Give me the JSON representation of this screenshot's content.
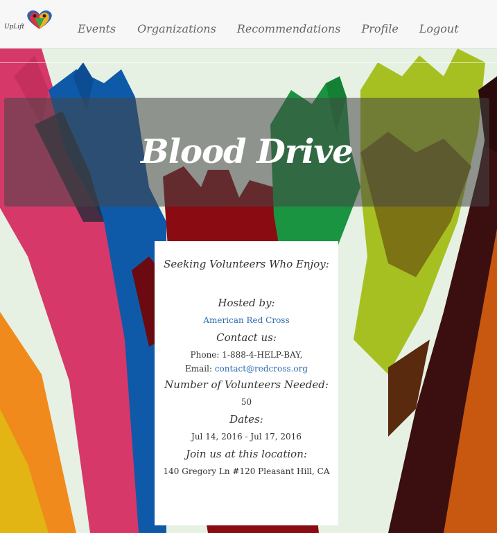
{
  "brand": {
    "text": "UpLift"
  },
  "nav": {
    "events": "Events",
    "organizations": "Organizations",
    "recommendations": "Recommendations",
    "profile": "Profile",
    "logout": "Logout"
  },
  "event": {
    "title": "Blood Drive",
    "seeking_label": "Seeking Volunteers Who Enjoy:",
    "hosted_label": "Hosted by:",
    "host_name": "American Red Cross",
    "contact_label": "Contact us:",
    "phone_line": "Phone: 1-888-4-HELP-BAY,",
    "email_prefix": "Email:",
    "email": "contact@redcross.org",
    "volunteers_label": "Number of Volunteers Needed:",
    "volunteers_needed": "50",
    "dates_label": "Dates:",
    "dates": "Jul 14, 2016 - Jul 17, 2016",
    "location_label": "Join us at this location:",
    "location": "140 Gregory Ln #120 Pleasant Hill, CA"
  },
  "colors": {
    "link": "#2b6cb0",
    "banner": "#464646",
    "background": "#e8f2e6"
  }
}
